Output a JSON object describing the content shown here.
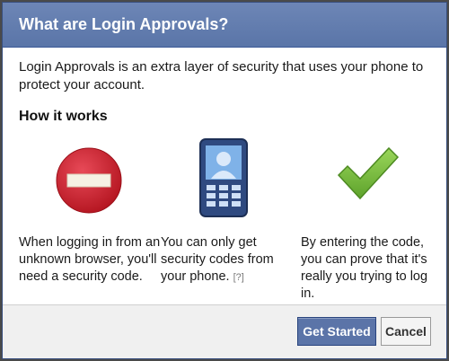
{
  "dialog": {
    "title": "What are Login Approvals?",
    "intro": "Login Approvals is an extra layer of security that uses your phone to protect your account.",
    "section_heading": "How it works"
  },
  "steps": [
    {
      "icon": "no-entry-icon",
      "text": "When logging in from an unknown browser, you'll need a security code."
    },
    {
      "icon": "phone-icon",
      "text": "You can only get security codes from your phone.",
      "help_link": "[?]"
    },
    {
      "icon": "checkmark-icon",
      "text": "By entering the code, you can prove that it's really you trying to log in."
    }
  ],
  "footer": {
    "primary_label": "Get Started",
    "secondary_label": "Cancel"
  },
  "colors": {
    "header": "#6b84b4",
    "primary_button": "#5b74a8",
    "stop_red": "#cc1a2e",
    "check_green": "#7cc242",
    "phone_blue": "#2f4a80"
  }
}
